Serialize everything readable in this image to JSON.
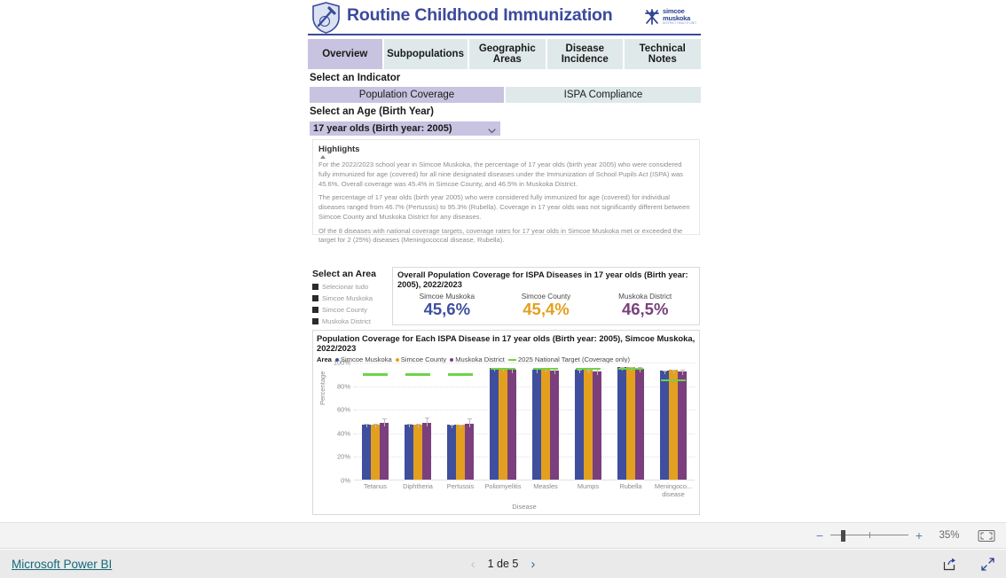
{
  "report": {
    "header": {
      "title": "Routine Childhood Immunization",
      "shield_icon": "shield-syringe-icon",
      "org_logo": {
        "icon": "simcoe-muskoka-mark-icon",
        "line1": "simcoe",
        "line2": "muskoka",
        "line3": "DISTRICT HEALTH UNIT"
      }
    },
    "tabs": [
      {
        "label": "Overview",
        "active": true
      },
      {
        "label": "Subpopulations",
        "active": false
      },
      {
        "label": "Geographic Areas",
        "active": false
      },
      {
        "label": "Disease Incidence",
        "active": false
      },
      {
        "label": "Technical Notes",
        "active": false
      }
    ],
    "indicator": {
      "label": "Select an Indicator",
      "options": [
        "Population Coverage",
        "ISPA Compliance"
      ],
      "selected": "Population Coverage"
    },
    "age": {
      "label": "Select an Age (Birth Year)",
      "selected": "17 year olds (Birth year: 2005)",
      "chevron_icon": "chevron-down-icon"
    },
    "highlights": {
      "title": "Highlights",
      "paragraphs": [
        "For the 2022/2023 school year in Simcoe Muskoka, the percentage of 17 year olds (birth year 2005) who were considered fully immunized for age (covered) for all nine designated diseases under the Immunization of School Pupils Act (ISPA) was 45.6%. Overall coverage was 45.4% in Simcoe County, and 46.5% in Muskoka District.",
        "The percentage of 17 year olds (birth year 2005) who were considered fully immunized for age (covered) for individual diseases ranged from 46.7% (Pertussis) to 95.3% (Rubella). Coverage in 17 year olds was not significantly different between Simcoe County and Muskoka District for any diseases.",
        "Of the 8 diseases with national coverage targets, coverage rates for 17 year olds in Simcoe Muskoka met or exceeded the target for 2 (25%) diseases (Meningococcal disease, Rubella)."
      ]
    },
    "area_slicer": {
      "label": "Select an Area",
      "items": [
        {
          "label": "Selecionar tudo",
          "checked": true
        },
        {
          "label": "Simcoe Muskoka",
          "checked": true
        },
        {
          "label": "Simcoe County",
          "checked": true
        },
        {
          "label": "Muskoka District",
          "checked": true
        }
      ]
    },
    "kpi_card": {
      "title": "Overall Population Coverage for ISPA Diseases in 17 year olds (Birth year: 2005), 2022/2023",
      "items": [
        {
          "name": "Simcoe Muskoka",
          "value": "45,6%",
          "color": "#3f4f9e"
        },
        {
          "name": "Simcoe County",
          "value": "45,4%",
          "color": "#e3a01e"
        },
        {
          "name": "Muskoka District",
          "value": "46,5%",
          "color": "#7b3f7d"
        }
      ]
    }
  },
  "chart_data": {
    "type": "bar",
    "title": "Population Coverage for Each ISPA Disease in 17 year olds (Birth year: 2005), Simcoe Muskoka, 2022/2023",
    "legend_title": "Area",
    "legend_position": "top",
    "xlabel": "Disease",
    "ylabel": "Percentage",
    "ylim": [
      0,
      100
    ],
    "yticks": [
      0,
      20,
      40,
      60,
      80,
      100
    ],
    "ytick_labels": [
      "0%",
      "20%",
      "40%",
      "60%",
      "80%",
      "100%"
    ],
    "grid": true,
    "categories": [
      "Tetanus",
      "Diphtheria",
      "Pertussis",
      "Poliomyelitis",
      "Measles",
      "Mumps",
      "Rubella",
      "Meningoco... disease"
    ],
    "category_labels": [
      [
        "Tetanus"
      ],
      [
        "Diphtheria"
      ],
      [
        "Pertussis"
      ],
      [
        "Poliomyelitis"
      ],
      [
        "Measles"
      ],
      [
        "Mumps"
      ],
      [
        "Rubella"
      ],
      [
        "Meningoco...",
        "disease"
      ]
    ],
    "series": [
      {
        "name": "Simcoe Muskoka",
        "color": "#3f4f9e",
        "values": [
          47.0,
          47.0,
          46.7,
          94.7,
          93.6,
          93.3,
          95.3,
          92.4
        ]
      },
      {
        "name": "Simcoe County",
        "color": "#e3a01e",
        "values": [
          46.9,
          46.9,
          46.6,
          94.8,
          93.7,
          93.4,
          95.4,
          92.9
        ]
      },
      {
        "name": "Muskoka District",
        "color": "#7b3f7d",
        "values": [
          48.2,
          48.3,
          47.5,
          93.4,
          92.4,
          92.0,
          93.9,
          91.6
        ]
      }
    ],
    "error_bars": [
      {
        "series": "Simcoe Muskoka",
        "upper": [
          48.0,
          48.0,
          47.7,
          95.4,
          94.4,
          94.1,
          96.0,
          93.3
        ]
      },
      {
        "series": "Simcoe County",
        "upper": [
          48.0,
          48.0,
          47.7,
          95.6,
          94.5,
          94.2,
          96.1,
          93.8
        ]
      },
      {
        "series": "Muskoka District",
        "upper": [
          53.0,
          53.2,
          52.4,
          95.8,
          95.0,
          94.6,
          96.2,
          94.3
        ]
      }
    ],
    "target_line": {
      "name": "2025 National Target (Coverage only)",
      "color": "#6fd34a",
      "values": [
        90,
        90,
        90,
        95,
        95,
        95,
        95,
        85
      ]
    }
  },
  "zoombar": {
    "minus": "−",
    "plus": "+",
    "percent": "35%",
    "fit_icon": "fit-to-page-icon"
  },
  "footer": {
    "brand_link": "Microsoft Power BI",
    "prev_icon": "chevron-left-icon",
    "next_icon": "chevron-right-icon",
    "page_text": "1 de 5",
    "share_icon": "share-icon",
    "fullscreen_icon": "fullscreen-icon"
  }
}
